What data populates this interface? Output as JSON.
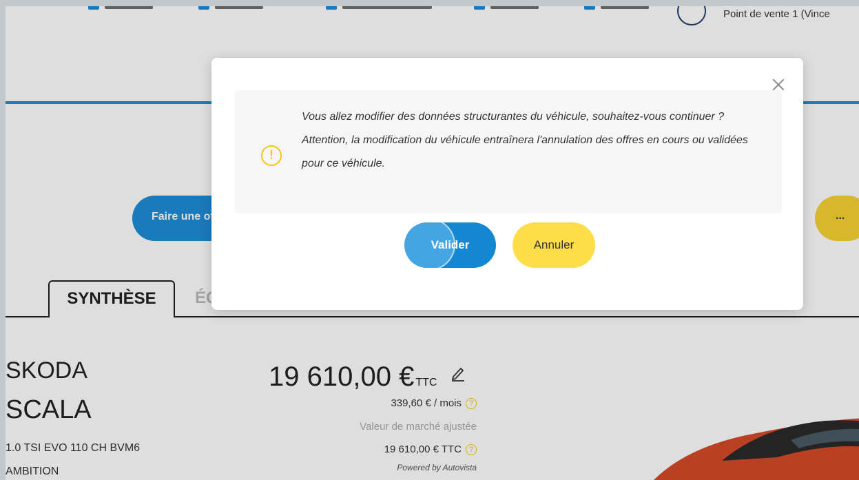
{
  "header": {
    "store_name": "Point de vente 1 (Vince"
  },
  "actions": {
    "offer_label": "Faire une offre",
    "more_label": "..."
  },
  "tabs": [
    {
      "label": "SYNTHÈSE"
    },
    {
      "label": "ÉQ"
    }
  ],
  "vehicle": {
    "brand": "SKODA",
    "model": "SCALA",
    "version_line1": "1.0 TSI EVO 110 CH BVM6",
    "version_line2": "AMBITION"
  },
  "pricing": {
    "price": "19 610,00 €",
    "price_suffix": "TTC",
    "monthly": "339,60 € / mois",
    "market_label": "Valeur de marché ajustée",
    "market_value": "19 610,00 € TTC",
    "powered_by": "Powered by Autovista"
  },
  "modal": {
    "message_line1": "Vous allez modifier des données structurantes du véhicule, souhaitez-vous continuer ?",
    "message_line2": "Attention, la modification du véhicule entraînera l'annulation des offres en cours ou validées pour ce véhicule.",
    "confirm_label": "Valider",
    "cancel_label": "Annuler"
  },
  "colors": {
    "primary_blue": "#1487d3",
    "accent_yellow": "#fddd4a",
    "warning": "#f7c41a"
  },
  "icons": {
    "close": "close-icon",
    "warning": "warning-icon",
    "edit": "pencil-icon",
    "help": "help-icon"
  }
}
